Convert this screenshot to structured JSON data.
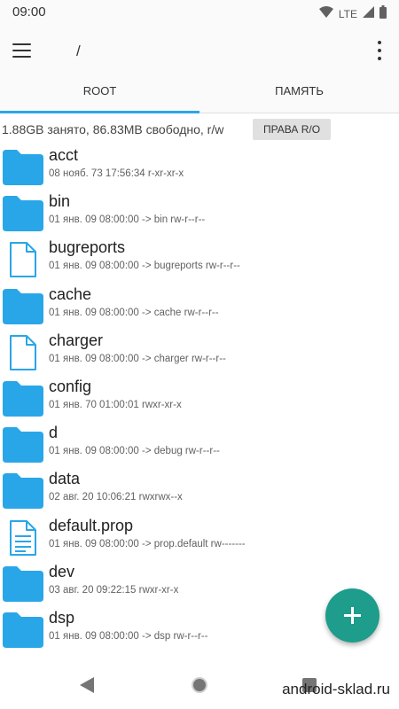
{
  "status_bar": {
    "time": "09:00",
    "network_label": "LTE",
    "icons": [
      "wifi-icon",
      "signal-icon",
      "battery-icon"
    ]
  },
  "app_bar": {
    "path": "/",
    "menu_icon": "hamburger-menu-icon",
    "more_icon": "more-vert-icon"
  },
  "tabs": [
    {
      "label": "ROOT",
      "active": true
    },
    {
      "label": "ПАМЯТЬ",
      "active": false
    }
  ],
  "info": {
    "storage_text": "1.88GB занято, 86.83MB свободно, r/w",
    "ro_button": "ПРАВА R/O"
  },
  "files": [
    {
      "name": "acct",
      "meta": "08 нояб. 73 17:56:34   r-xr-xr-x",
      "icon": "folder-icon"
    },
    {
      "name": "bin",
      "meta": "01 янв. 09 08:00:00  -> bin  rw-r--r--",
      "icon": "folder-icon"
    },
    {
      "name": "bugreports",
      "meta": "01 янв. 09 08:00:00  -> bugreports  rw-r--r--",
      "icon": "file-icon"
    },
    {
      "name": "cache",
      "meta": "01 янв. 09 08:00:00  -> cache  rw-r--r--",
      "icon": "folder-icon"
    },
    {
      "name": "charger",
      "meta": "01 янв. 09 08:00:00  -> charger  rw-r--r--",
      "icon": "file-icon"
    },
    {
      "name": "config",
      "meta": "01 янв. 70 01:00:01    rwxr-xr-x",
      "icon": "folder-icon"
    },
    {
      "name": "d",
      "meta": "01 янв. 09 08:00:00  -> debug  rw-r--r--",
      "icon": "folder-icon"
    },
    {
      "name": "data",
      "meta": "02 авг. 20 10:06:21    rwxrwx--x",
      "icon": "folder-icon"
    },
    {
      "name": "default.prop",
      "meta": "01 янв. 09 08:00:00  -> prop.default  rw-------",
      "icon": "text-file-icon"
    },
    {
      "name": "dev",
      "meta": "03 авг. 20 09:22:15    rwxr-xr-x",
      "icon": "folder-icon"
    },
    {
      "name": "dsp",
      "meta": "01 янв. 09 08:00:00  -> dsp  rw-r--r--",
      "icon": "folder-icon"
    }
  ],
  "fab": {
    "icon": "plus-icon"
  },
  "nav_bar": {
    "icons": [
      "back-icon",
      "home-icon",
      "recents-icon"
    ]
  },
  "watermark": "android-sklad.ru",
  "colors": {
    "accent": "#29a6e8",
    "folder": "#29a6e8",
    "fab": "#1e9c8c"
  }
}
